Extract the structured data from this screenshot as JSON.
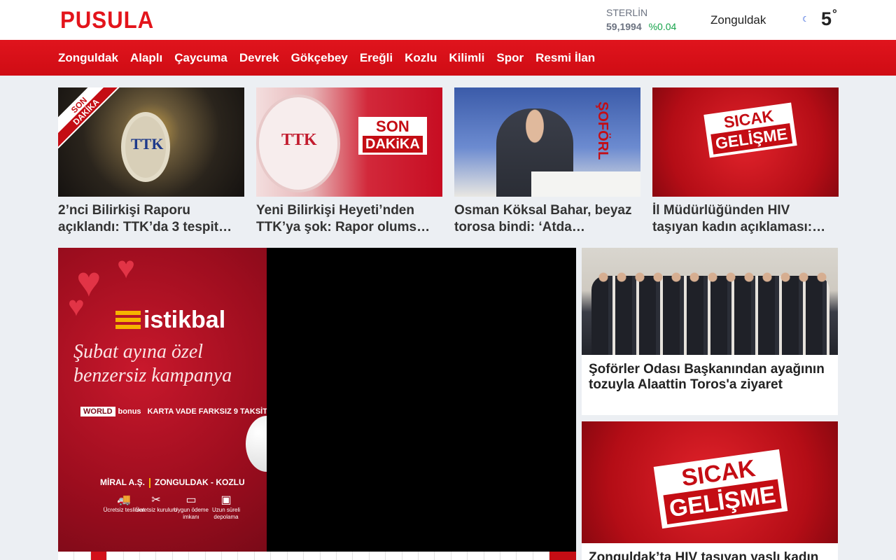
{
  "header": {
    "logo": "PUSULA",
    "currency": {
      "name": "STERLİN",
      "value": "59,1994",
      "change": "%0.04"
    },
    "weather": {
      "city": "Zonguldak",
      "temp": "5",
      "unit": "°",
      "icon": "moon-icon"
    }
  },
  "nav": {
    "items": [
      "Zonguldak",
      "Alaplı",
      "Çaycuma",
      "Devrek",
      "Gökçebey",
      "Ereğli",
      "Kozlu",
      "Kilimli",
      "Spor",
      "Resmi İlan"
    ]
  },
  "top_cards": [
    {
      "title": "2’nci Bilirkişi Raporu açıklandı: TTK’da 3 tespit…",
      "image_ribbon": [
        "SON",
        "DAKİKA"
      ],
      "image_text": "TTK"
    },
    {
      "title": "Yeni Bilirkişi Heyeti’nden TTK’ya şok: Rapor olums…",
      "image_badge": [
        "SON",
        "DAKiKA"
      ],
      "image_text": "TTK"
    },
    {
      "title": "Osman Köksal Bahar, beyaz torosa bindi: ‘Atda…",
      "image_text": "ŞOFÖRL"
    },
    {
      "title": "İl Müdürlüğünden HIV taşıyan kadın açıklaması:…",
      "image_badge": [
        "SICAK",
        "GELİŞME"
      ]
    }
  ],
  "ad": {
    "brand": "istikbal",
    "slogan": [
      "Şubat ayına özel",
      "benzersiz kampanya"
    ],
    "promo_card": [
      "WORLD",
      "bonus"
    ],
    "promo_text": "KARTA VADE FARKSIZ 9 TAKSİT",
    "company": "MİRAL A.Ş.",
    "location": "ZONGULDAK - KOZLU",
    "features": [
      "Ücretsiz teslimat",
      "Ücretsiz kurulum",
      "Uygun ödeme imkanı",
      "Uzun süreli depolama"
    ]
  },
  "side_stories": [
    {
      "title": "Şoförler Odası Başkanından ayağının tozuyla Alaattin Toros'a ziyaret"
    },
    {
      "title": "Zonguldak’ta HIV taşıyan yaşlı kadın",
      "image_badge": [
        "SICAK",
        "GELİŞME"
      ]
    }
  ],
  "colors": {
    "brand_red": "#e3141b",
    "nav_red": "#d70f18",
    "change_green": "#16a34a"
  }
}
